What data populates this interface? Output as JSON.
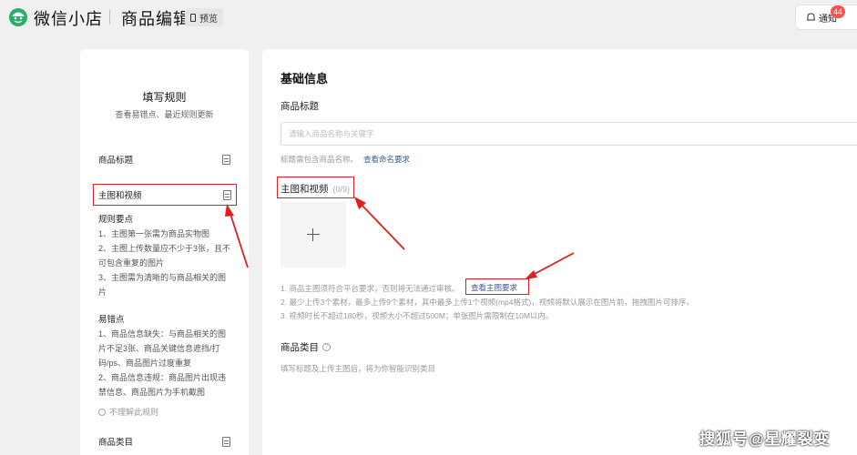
{
  "header": {
    "app_title": "微信小店",
    "page_title": "商品编辑",
    "preview_label": "预览",
    "notify_label": "通知",
    "notify_count": "44"
  },
  "rules": {
    "title": "填写规则",
    "subtitle": "查看易错点、最近规则更新",
    "items": [
      {
        "label": "商品标题"
      },
      {
        "label": "主图和视频"
      },
      {
        "label": "商品类目"
      }
    ],
    "key_points_heading": "规则要点",
    "key_points": [
      "1、主图第一张需为商品实物图",
      "2、主图上传数量应不少于3张，且不可包含重复的图片",
      "3、主图需为清晰的与商品相关的图片"
    ],
    "pitfalls_heading": "易错点",
    "pitfalls": [
      "1、商品信息缺失：与商品相关的图片不足3张、商品关键信息遮挡/打码/ps、商品图片过度重复",
      "2、商品信息违规：商品图片出现违禁信息、商品图片为手机截图"
    ],
    "help_link": "不理解此规则"
  },
  "form": {
    "heading": "基础信息",
    "title_label": "商品标题",
    "title_placeholder": "请输入商品名称与关键字",
    "title_hint": "标题需包含商品名称。",
    "title_hint_link": "查看命名要求",
    "media_label": "主图和视频",
    "media_count": "(0/9)",
    "media_req_1": "1. 商品主图须符合平台要求，否则将无法通过审核。",
    "media_req_link": "查看主图要求",
    "media_req_2": "2. 最少上传3个素材，最多上传9个素材，其中最多上传1个视频(mp4格式)，视频将默认展示在图片前，拖拽图片可排序。",
    "media_req_3": "3. 视频时长不超过180秒，视频大小不超过500M；单张图片需限制在10M以内。",
    "category_label": "商品类目",
    "category_hint": "填写标题及上传主图后，将为你智能识别类目"
  },
  "watermark": "搜狐号@星耀裂变",
  "colors": {
    "annotation_red": "#e02020",
    "link_blue": "#3b5c8f",
    "brand_green": "#07c160",
    "badge_red": "#fa5151"
  }
}
